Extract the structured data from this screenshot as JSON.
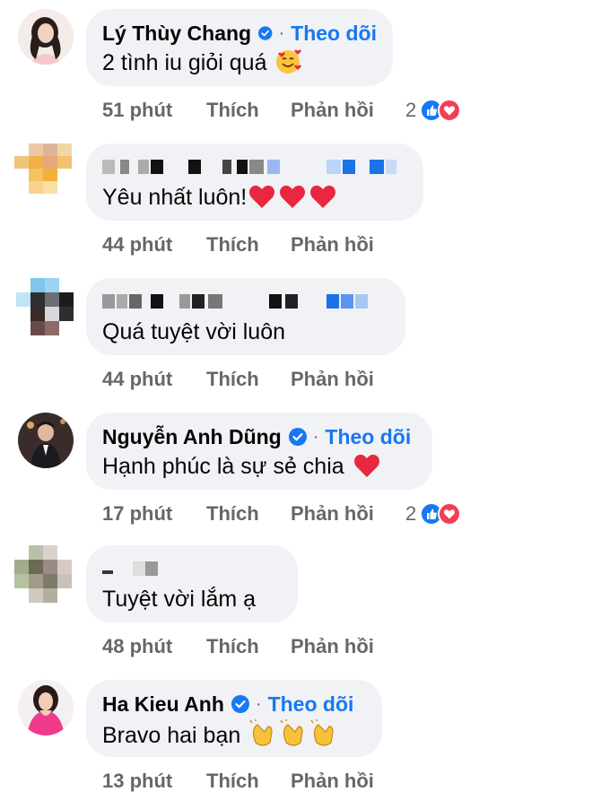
{
  "comments": [
    {
      "name": "Lý Thùy Chang",
      "verified": true,
      "follow_label": "Theo dõi",
      "text": "2 tình iu giỏi quá",
      "time": "51 phút",
      "like_label": "Thích",
      "reply_label": "Phản hồi",
      "reaction_count": "2",
      "reactions": [
        "like-icon",
        "love-icon"
      ],
      "emoji": "smiling-face-with-hearts-icon"
    },
    {
      "name_hidden": true,
      "text": "Yêu nhất luôn!",
      "time": "44 phút",
      "like_label": "Thích",
      "reply_label": "Phản hồi",
      "emoji": "red-heart-icon x3"
    },
    {
      "name_hidden": true,
      "text": "Quá tuyệt vời luôn",
      "time": "44 phút",
      "like_label": "Thích",
      "reply_label": "Phản hồi"
    },
    {
      "name": "Nguyễn Anh Dũng",
      "verified": true,
      "follow_label": "Theo dõi",
      "text": "Hạnh phúc là sự sẻ chia",
      "time": "17 phút",
      "like_label": "Thích",
      "reply_label": "Phản hồi",
      "reaction_count": "2",
      "reactions": [
        "like-icon",
        "love-icon"
      ],
      "emoji": "red-heart-icon"
    },
    {
      "name_hidden": true,
      "text": "Tuyệt vời lắm ạ",
      "time": "48 phút",
      "like_label": "Thích",
      "reply_label": "Phản hồi"
    },
    {
      "name": "Ha Kieu Anh",
      "verified": true,
      "follow_label": "Theo dõi",
      "text": "Bravo hai bạn",
      "time": "13 phút",
      "like_label": "Thích",
      "reply_label": "Phản hồi",
      "emoji": "clapping-hands-icon x3"
    }
  ],
  "colors": {
    "bubble": "#f0f2f5",
    "link_blue": "#1877f2",
    "meta_gray": "#65676b",
    "love_red": "#f33e58"
  }
}
